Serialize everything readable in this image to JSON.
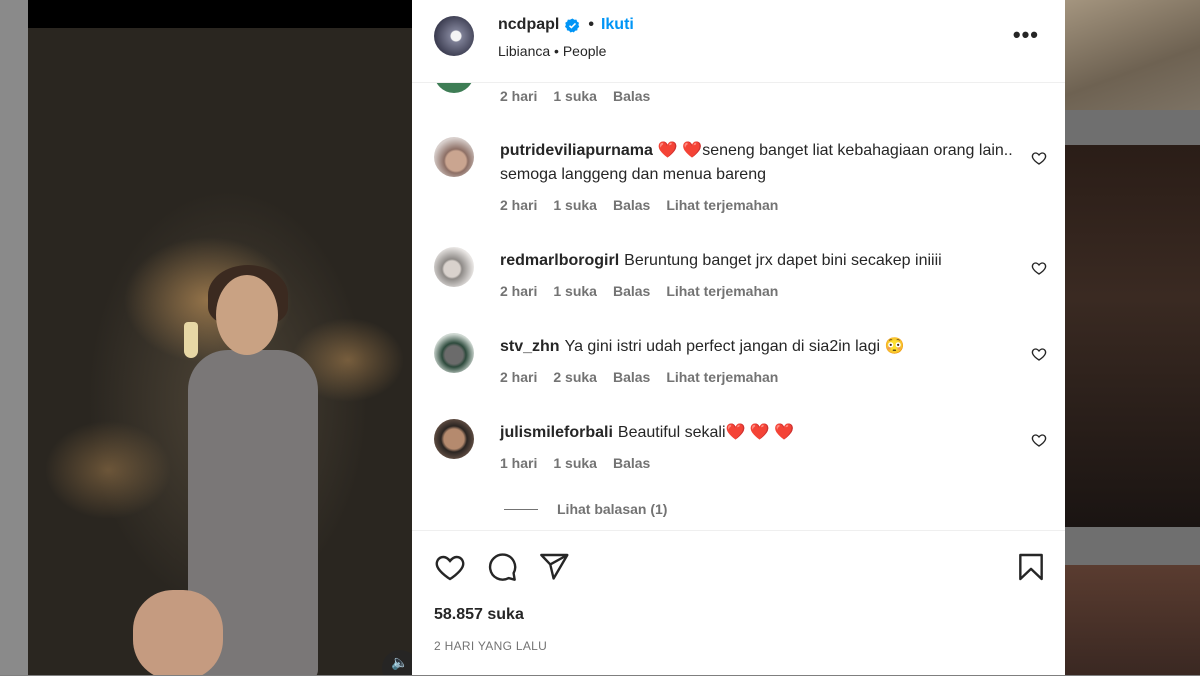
{
  "header": {
    "username": "ncdpapl",
    "follow_label": "Ikuti",
    "audio": "Libianca • People",
    "more_icon": "more-horizontal-icon"
  },
  "partial_comment": {
    "time": "2 hari",
    "likes": "1 suka",
    "reply": "Balas"
  },
  "comments": [
    {
      "user": "putridevilia purnama",
      "text": "❤️ ❤️seneng banget liat kebahagiaan orang lain.. semoga langgeng dan menua bareng",
      "time": "2 hari",
      "likes": "1 suka",
      "reply": "Balas",
      "translate": "Lihat terjemahan"
    },
    {
      "user": "redmarlborogirl",
      "text": "Beruntung banget jrx dapet bini secakep iniiii",
      "time": "2 hari",
      "likes": "1 suka",
      "reply": "Balas",
      "translate": "Lihat terjemahan"
    },
    {
      "user": "stv_zhn",
      "text": "Ya gini istri udah perfect jangan di sia2in lagi 😳",
      "time": "2 hari",
      "likes": "2 suka",
      "reply": "Balas",
      "translate": "Lihat terjemahan"
    },
    {
      "user": "julismileforbali",
      "text": "Beautiful sekali❤️ ❤️ ❤️",
      "time": "1 hari",
      "likes": "1 suka",
      "reply": "Balas"
    }
  ],
  "view_replies": "Lihat balasan (1)",
  "actions": {
    "like_icon": "heart-icon",
    "comment_icon": "comment-icon",
    "share_icon": "send-icon",
    "save_icon": "bookmark-icon"
  },
  "likes_count": "58.857 suka",
  "posted_time": "2 HARI YANG LALU",
  "media": {
    "sound_icon": "speaker-icon"
  },
  "colors": {
    "accent": "#0095f6",
    "text": "#262626",
    "muted": "#737373"
  }
}
